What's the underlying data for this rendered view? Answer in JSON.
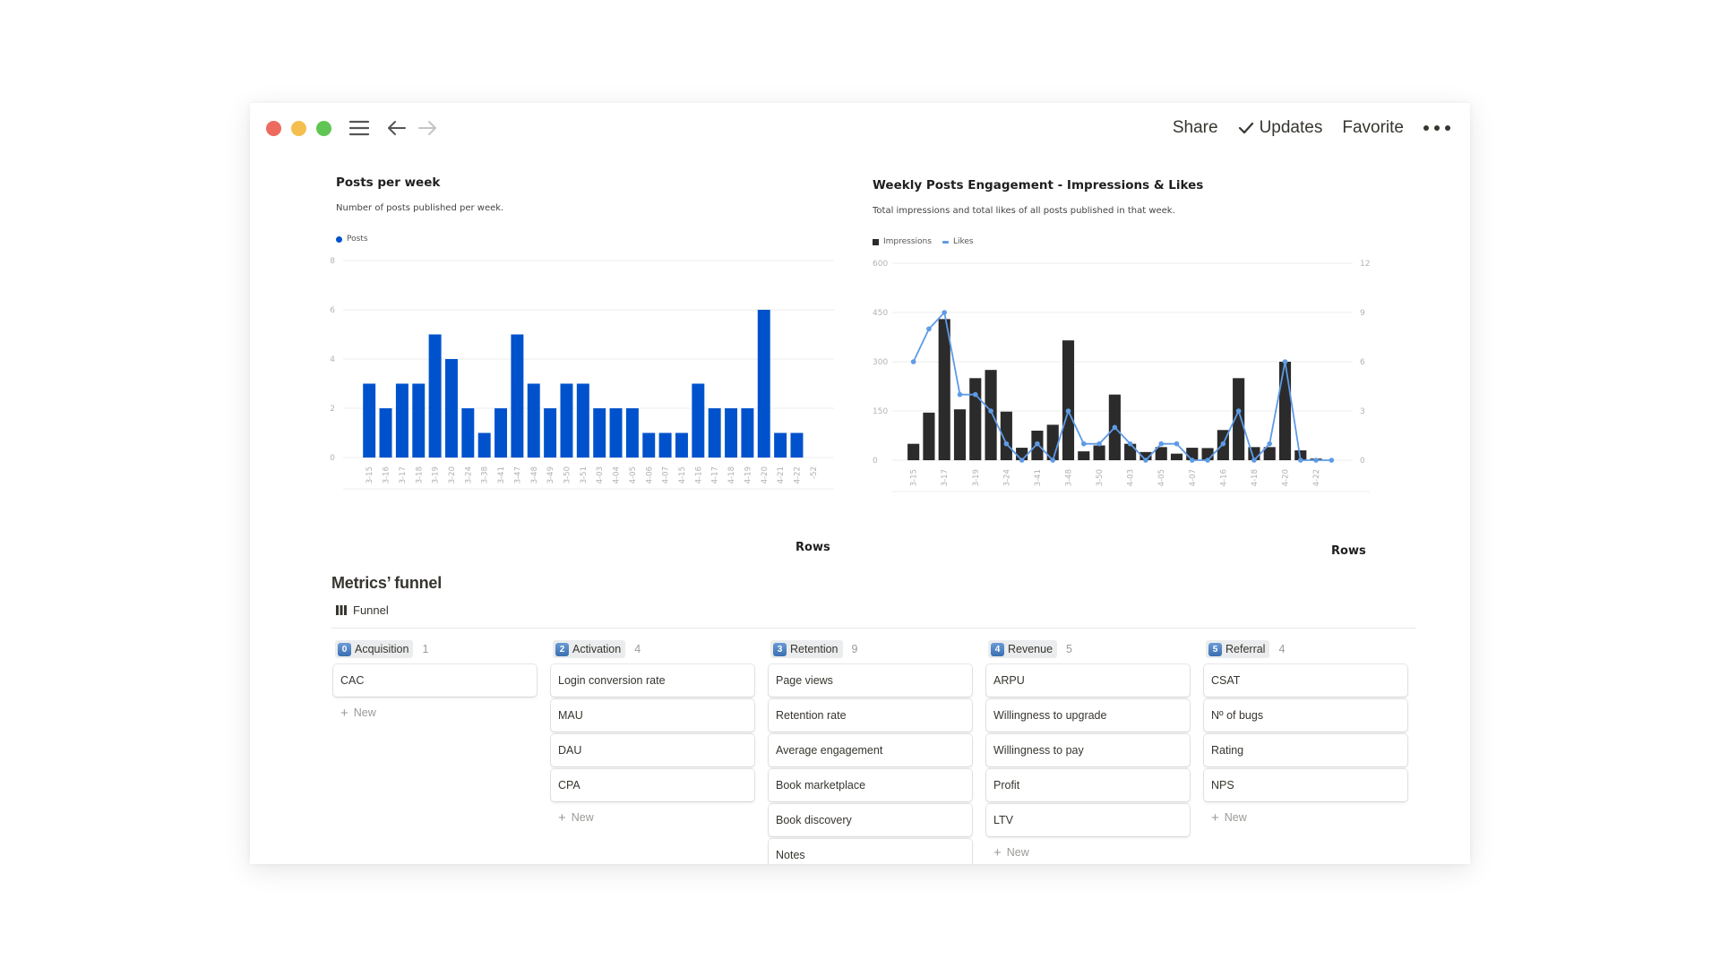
{
  "titlebar": {
    "share_label": "Share",
    "updates_label": "Updates",
    "favorite_label": "Favorite",
    "icons": [
      "close-light",
      "minimize-light",
      "zoom-light",
      "menu-icon",
      "back-arrow-icon",
      "forward-arrow-icon",
      "check-icon",
      "more-icon"
    ]
  },
  "posts_chart": {
    "title": "Posts per week",
    "subtitle": "Number of posts published per week.",
    "legend_label": "Posts",
    "axis_footer": "Rows"
  },
  "engagement_chart": {
    "title": "Weekly Posts Engagement - Impressions & Likes",
    "subtitle": "Total impressions and total likes of all posts published in that week.",
    "legend_impressions": "Impressions",
    "legend_likes": "Likes",
    "axis_footer": "Rows"
  },
  "chart_data": [
    {
      "type": "bar",
      "title": "Posts per week",
      "subtitle": "Number of posts published per week.",
      "xlabel": "Rows",
      "ylabel": "",
      "categories": [
        "3-15",
        "3-16",
        "3-17",
        "3-18",
        "3-19",
        "3-20",
        "3-24",
        "3-38",
        "3-41",
        "3-47",
        "3-48",
        "3-49",
        "3-50",
        "3-51",
        "4-03",
        "4-04",
        "4-05",
        "4-06",
        "4-07",
        "4-15",
        "4-16",
        "4-17",
        "4-18",
        "4-19",
        "4-20",
        "4-21",
        "4-22",
        "-52"
      ],
      "series": [
        {
          "name": "Posts",
          "color": "#0052cc",
          "values": [
            3,
            2,
            3,
            3,
            5,
            4,
            2,
            1,
            2,
            5,
            3,
            2,
            3,
            3,
            2,
            2,
            2,
            1,
            1,
            1,
            3,
            2,
            2,
            2,
            6,
            1,
            1,
            0
          ]
        }
      ],
      "yticks": [
        0,
        2,
        4,
        6,
        8
      ],
      "ylim": [
        0,
        8
      ],
      "grid": true,
      "legend": "top-left"
    },
    {
      "type": "bar",
      "title": "Weekly Posts Engagement - Impressions & Likes",
      "subtitle": "Total impressions and total likes of all posts published in that week.",
      "xlabel": "Rows",
      "categories": [
        "3-15",
        "3-16",
        "3-17",
        "3-18",
        "3-19",
        "3-20",
        "3-24",
        "3-38",
        "3-41",
        "3-47",
        "3-48",
        "3-49",
        "3-50",
        "3-51",
        "4-03",
        "4-04",
        "4-05",
        "4-06",
        "4-07",
        "4-15",
        "4-16",
        "4-17",
        "4-18",
        "4-19",
        "4-20",
        "4-21",
        "4-22",
        "-52"
      ],
      "visible_xticks": [
        "3-15",
        "3-17",
        "3-19",
        "3-24",
        "3-41",
        "3-48",
        "3-50",
        "4-03",
        "4-05",
        "4-07",
        "4-16",
        "4-18",
        "4-20",
        "4-22"
      ],
      "series": [
        {
          "name": "Impressions",
          "type": "bar",
          "axis": "left",
          "color": "#2b2b2b",
          "values": [
            50,
            145,
            430,
            155,
            250,
            275,
            148,
            38,
            90,
            108,
            365,
            27,
            45,
            200,
            50,
            25,
            40,
            20,
            38,
            37,
            92,
            250,
            40,
            40,
            300,
            30,
            5,
            0
          ]
        },
        {
          "name": "Likes",
          "type": "line",
          "axis": "right",
          "color": "#5e9be6",
          "values": [
            6,
            8,
            9,
            4,
            4,
            3,
            1,
            0,
            1,
            0,
            3,
            1,
            1,
            2,
            1,
            0,
            1,
            1,
            0,
            0,
            1,
            3,
            0,
            1,
            6,
            0,
            0,
            0
          ]
        }
      ],
      "yticks_left": [
        0,
        150,
        300,
        450,
        600
      ],
      "yticks_right": [
        0,
        3,
        6,
        9,
        12
      ],
      "ylim_left": [
        0,
        600
      ],
      "ylim_right": [
        0,
        12
      ],
      "grid": true,
      "legend": "top-left"
    }
  ],
  "funnel": {
    "heading": "Metrics’ funnel",
    "view_label": "Funnel",
    "new_label": "New",
    "columns": [
      {
        "badge": "0",
        "label": "Acquisition",
        "count": "1",
        "cards": [
          "CAC"
        ],
        "show_new": true
      },
      {
        "badge": "2",
        "label": "Activation",
        "count": "4",
        "cards": [
          "Login conversion rate",
          "MAU",
          "DAU",
          "CPA"
        ],
        "show_new": true
      },
      {
        "badge": "3",
        "label": "Retention",
        "count": "9",
        "cards": [
          "Page views",
          "Retention rate",
          "Average engagement",
          "Book marketplace",
          "Book discovery",
          "Notes"
        ],
        "show_new": false
      },
      {
        "badge": "4",
        "label": "Revenue",
        "count": "5",
        "cards": [
          "ARPU",
          "Willingness to upgrade",
          "Willingness to pay",
          "Profit",
          "LTV"
        ],
        "show_new": true
      },
      {
        "badge": "5",
        "label": "Referral",
        "count": "4",
        "cards": [
          "CSAT",
          "Nº of bugs",
          "Rating",
          "NPS"
        ],
        "show_new": true
      }
    ]
  }
}
